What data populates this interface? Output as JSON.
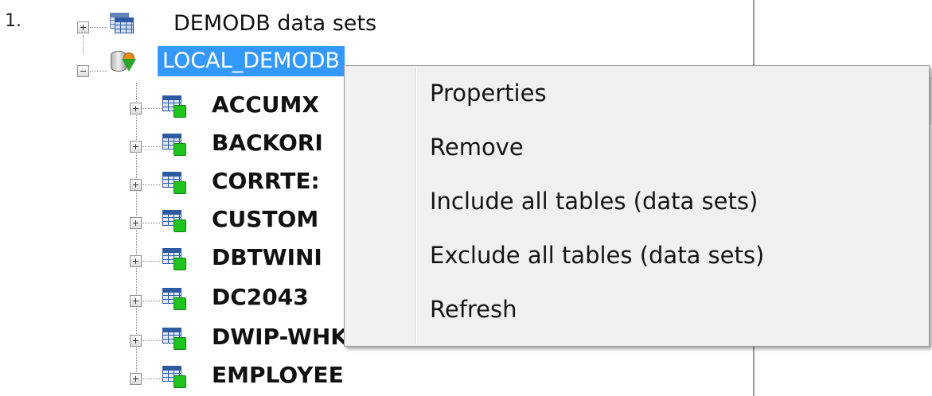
{
  "step_number": "1.",
  "tree": {
    "root_label": "DEMODB data sets",
    "connection_label": "LOCAL_DEMODB",
    "tables": [
      "ACCUMX",
      "BACKORI",
      "CORRTE:",
      "CUSTOM",
      "DBTWINI",
      "DC2043",
      "DWIP-WHK HM THC",
      "EMPLOYEE"
    ]
  },
  "context_menu": {
    "items": [
      "Properties",
      "Remove",
      "Include all tables (data sets)",
      "Exclude all tables (data sets)",
      "Refresh"
    ]
  },
  "icons": {
    "root": "table-stack-icon",
    "connection": "database-connection-icon",
    "table": "table-icon",
    "expander_expanded": "minus-expander-icon",
    "expander_collapsed": "plus-expander-icon"
  },
  "colors": {
    "selection": "#3399ff",
    "menu_background": "#f0f0f0",
    "badge": "#1fc41f"
  }
}
